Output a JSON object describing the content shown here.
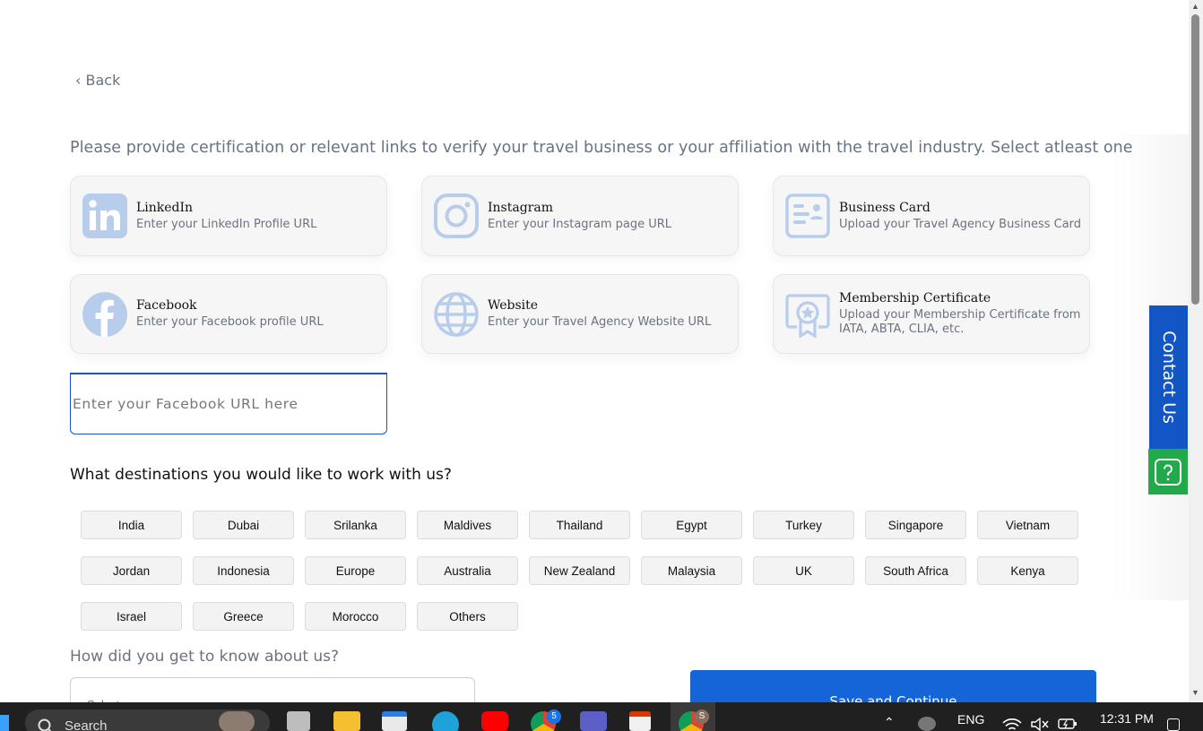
{
  "back_label": "‹ Back",
  "instructions": "Please provide certification or relevant links to verify your travel business or your affiliation with the travel industry. Select atleast one",
  "cards": [
    {
      "title": "LinkedIn",
      "subtitle": "Enter your LinkedIn Profile URL",
      "icon": "linkedin-icon"
    },
    {
      "title": "Instagram",
      "subtitle": "Enter your Instagram page URL",
      "icon": "instagram-icon"
    },
    {
      "title": "Business Card",
      "subtitle": "Upload your Travel Agency Business Card",
      "icon": "business-card-icon"
    },
    {
      "title": "Facebook",
      "subtitle": "Enter your Facebook profile URL",
      "icon": "facebook-icon"
    },
    {
      "title": "Website",
      "subtitle": "Enter your Travel Agency Website URL",
      "icon": "globe-icon"
    },
    {
      "title": "Membership Certificate",
      "subtitle_line1": "Upload your Membership Certificate from",
      "subtitle_line2": "IATA, ABTA, CLIA, etc.",
      "icon": "certificate-icon"
    }
  ],
  "facebook_input": {
    "value": "",
    "placeholder": "Enter your Facebook URL here"
  },
  "destinations_heading": "What destinations you would like to work with us?",
  "destinations": [
    "India",
    "Dubai",
    "Srilanka",
    "Maldives",
    "Thailand",
    "Egypt",
    "Turkey",
    "Singapore",
    "Vietnam",
    "Jordan",
    "Indonesia",
    "Europe",
    "Australia",
    "New Zealand",
    "Malaysia",
    "UK",
    "South Africa",
    "Kenya",
    "Israel",
    "Greece",
    "Morocco",
    "Others"
  ],
  "source_heading": "How did you get to know about us?",
  "source_select_value": "Select",
  "save_label": "Save and Continue",
  "contact_label": "Contact Us",
  "taskbar": {
    "search_placeholder": "Search",
    "chrome_badge": "5",
    "chrome2_badge": "S",
    "language": "ENG",
    "time": "12:31 PM"
  },
  "colors": {
    "primary": "#1565d8",
    "contact_tab": "#1255c4",
    "help_tab": "#21a94a",
    "icon_tint": "#b8cdec"
  }
}
